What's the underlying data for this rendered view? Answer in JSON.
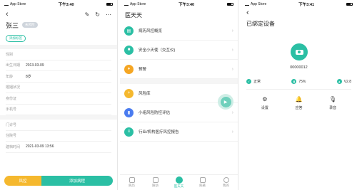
{
  "phone1": {
    "status": {
      "carrier": "App Store",
      "time": "下午3:40",
      "battery_icon": "battery-icon"
    },
    "back_icon": "‹",
    "header_actions": [
      "✎",
      "↻",
      "⋯"
    ],
    "name": "张三",
    "gray_tag": "未风险",
    "add_tag": "添加标签",
    "fields": [
      {
        "label": "性别",
        "value": ""
      },
      {
        "label": "出生日期",
        "value": "2013-03-09"
      },
      {
        "label": "年龄",
        "value": "8岁"
      },
      {
        "label": "婚姻状况",
        "value": ""
      },
      {
        "label": "身份证",
        "value": ""
      },
      {
        "label": "手机号",
        "value": ""
      }
    ],
    "fields2": [
      {
        "label": "门诊号",
        "value": ""
      },
      {
        "label": "住院号",
        "value": ""
      },
      {
        "label": "建档时间",
        "value": "2021-03-09 13:56"
      }
    ],
    "bottom": {
      "risk": "风控",
      "add": "添加病程"
    }
  },
  "phone2": {
    "status": {
      "carrier": "App Store",
      "time": "下午3:40"
    },
    "title": "医天天",
    "menu_group1": [
      {
        "label": "病历风控概览",
        "color": "#2bbfa4",
        "icon": "ledger"
      },
      {
        "label": "安全小天使（交互仪)",
        "color": "#2bbfa4",
        "icon": "camera"
      },
      {
        "label": "预警",
        "color": "#f5a623",
        "icon": "bell"
      }
    ],
    "menu_group2": [
      {
        "label": "风险库",
        "color": "#f5b82e",
        "icon": "plus"
      },
      {
        "label": "小组风险防控评估",
        "color": "#4a7cf0",
        "icon": "bookmark"
      },
      {
        "label": "行业/机构医疗风控报告",
        "color": "#2bbfa4",
        "icon": "doc"
      }
    ],
    "tabs": [
      {
        "label": "病历",
        "active": false
      },
      {
        "label": "随访",
        "active": false
      },
      {
        "label": "医天天",
        "active": true
      },
      {
        "label": "病著",
        "active": false
      },
      {
        "label": "我的",
        "active": false
      }
    ]
  },
  "phone3": {
    "status": {
      "carrier": "App Store",
      "time": "下午3:41"
    },
    "back_icon": "‹",
    "title": "已绑定设备",
    "device_id": "00000012",
    "stats": [
      {
        "icon": "check-icon",
        "glyph": "✓",
        "label": "正常"
      },
      {
        "icon": "battery-level-icon",
        "glyph": "▮",
        "label": "75%"
      },
      {
        "icon": "version-icon",
        "glyph": "▲",
        "label": "V2.8"
      }
    ],
    "actions": [
      {
        "icon": "settings-icon",
        "glyph": "⚙",
        "label": "设置"
      },
      {
        "icon": "bell-icon",
        "glyph": "🔔",
        "label": "应答"
      },
      {
        "icon": "mic-icon",
        "glyph": "🎙",
        "label": "录音"
      }
    ]
  }
}
